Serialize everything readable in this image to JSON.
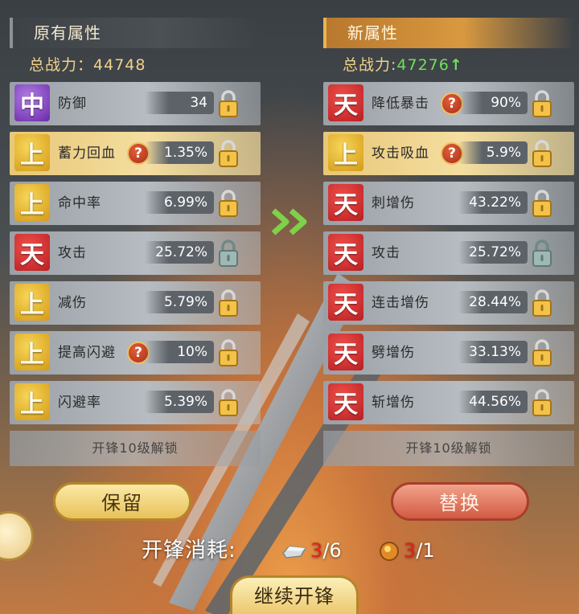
{
  "left": {
    "header": "原有属性",
    "power_label": "总战力：",
    "power_value": "44748",
    "rows": [
      {
        "badge": "中",
        "badge_color": "purple",
        "name": "防御",
        "value": "34",
        "help": false,
        "gold": false,
        "lock": "gold"
      },
      {
        "badge": "上",
        "badge_color": "gold",
        "name": "蓄力回血",
        "value": "1.35%",
        "help": true,
        "gold": true,
        "lock": "gold"
      },
      {
        "badge": "上",
        "badge_color": "gold",
        "name": "命中率",
        "value": "6.99%",
        "help": false,
        "gold": false,
        "lock": "gold"
      },
      {
        "badge": "天",
        "badge_color": "red",
        "name": "攻击",
        "value": "25.72%",
        "help": false,
        "gold": false,
        "lock": "teal"
      },
      {
        "badge": "上",
        "badge_color": "gold",
        "name": "减伤",
        "value": "5.79%",
        "help": false,
        "gold": false,
        "lock": "gold"
      },
      {
        "badge": "上",
        "badge_color": "gold",
        "name": "提高闪避",
        "value": "10%",
        "help": true,
        "gold": false,
        "lock": "gold"
      },
      {
        "badge": "上",
        "badge_color": "gold",
        "name": "闪避率",
        "value": "5.39%",
        "help": false,
        "gold": false,
        "lock": "gold"
      }
    ],
    "unlock_text": "开锋10级解锁"
  },
  "right": {
    "header": "新属性",
    "power_label": "总战力:",
    "power_value": "47276",
    "power_trend": "up",
    "rows": [
      {
        "badge": "天",
        "badge_color": "red",
        "name": "降低暴击",
        "value": "90%",
        "help": true,
        "gold": false,
        "lock": "gold"
      },
      {
        "badge": "上",
        "badge_color": "gold",
        "name": "攻击吸血",
        "value": "5.9%",
        "help": true,
        "gold": true,
        "lock": "gold"
      },
      {
        "badge": "天",
        "badge_color": "red",
        "name": "刺增伤",
        "value": "43.22%",
        "help": false,
        "gold": false,
        "lock": "gold"
      },
      {
        "badge": "天",
        "badge_color": "red",
        "name": "攻击",
        "value": "25.72%",
        "help": false,
        "gold": false,
        "lock": "teal"
      },
      {
        "badge": "天",
        "badge_color": "red",
        "name": "连击增伤",
        "value": "28.44%",
        "help": false,
        "gold": false,
        "lock": "gold"
      },
      {
        "badge": "天",
        "badge_color": "red",
        "name": "劈增伤",
        "value": "33.13%",
        "help": false,
        "gold": false,
        "lock": "gold"
      },
      {
        "badge": "天",
        "badge_color": "red",
        "name": "斩增伤",
        "value": "44.56%",
        "help": false,
        "gold": false,
        "lock": "gold"
      }
    ],
    "unlock_text": "开锋10级解锁"
  },
  "buttons": {
    "keep": "保留",
    "replace": "替换",
    "continue": "继续开锋"
  },
  "cost": {
    "label": "开锋消耗:",
    "ore_have": "3",
    "ore_need": "/6",
    "gem_have": "3",
    "gem_need": "/1"
  },
  "icons": {
    "help": "?",
    "lock": "padlock-icon",
    "arrow": "double-chevron-right-icon"
  },
  "colors": {
    "badge_gold": "#d49a16",
    "badge_red": "#b81e22",
    "badge_purple": "#6a2aa8",
    "power_up": "#6fe05a",
    "cost_red": "#e8201a"
  }
}
